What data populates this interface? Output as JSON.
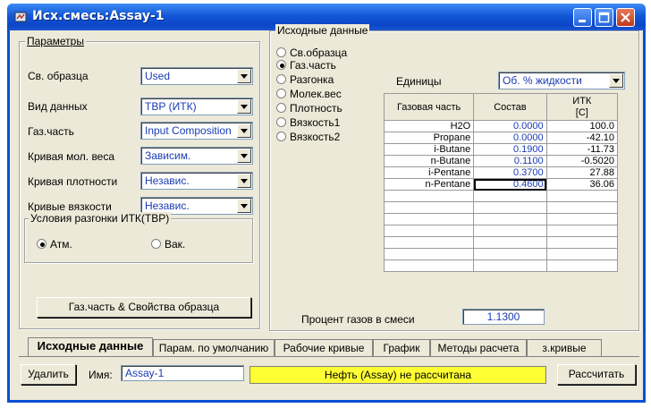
{
  "window": {
    "title": "Исх.смесь:Assay-1"
  },
  "params": {
    "group_label": "Параметры",
    "rows": [
      {
        "label": "Св. образца",
        "value": "Used"
      },
      {
        "label": "Вид данных",
        "value": "ТВР (ИТК)"
      },
      {
        "label": "Газ.часть",
        "value": "Input Composition"
      },
      {
        "label": "Кривая мол. веса",
        "value": "Зависим."
      },
      {
        "label": "Кривая плотности",
        "value": "Независ."
      },
      {
        "label": "Кривые вязкости",
        "value": "Независ."
      }
    ],
    "distill": {
      "group_label": "Условия разгонки ИТК(ТВР)",
      "options": [
        {
          "label": "Атм.",
          "selected": true
        },
        {
          "label": "Вак.",
          "selected": false
        }
      ]
    },
    "button_label": "Газ.часть & Свойства образца"
  },
  "source": {
    "group_label": "Исходные данные",
    "radios": [
      {
        "label": "Св.образца",
        "selected": false
      },
      {
        "label": "Газ.часть",
        "selected": true
      },
      {
        "label": "Разгонка",
        "selected": false
      },
      {
        "label": "Молек.вес",
        "selected": false
      },
      {
        "label": "Плотность",
        "selected": false
      },
      {
        "label": "Вязкость1",
        "selected": false
      },
      {
        "label": "Вязкость2",
        "selected": false
      }
    ],
    "units_label": "Единицы",
    "units_value": "Об. % жидкости",
    "table": {
      "headers": [
        "Газовая часть",
        "Состав",
        "ИТК",
        "[C]"
      ],
      "rows": [
        [
          "H2O",
          "0.0000",
          "100.0"
        ],
        [
          "Propane",
          "0.0000",
          "-42.10"
        ],
        [
          "i-Butane",
          "0.1900",
          "-11.73"
        ],
        [
          "n-Butane",
          "0.1100",
          "-0.5020"
        ],
        [
          "i-Pentane",
          "0.3700",
          "27.88"
        ],
        [
          "n-Pentane",
          "0.4600",
          "36.06"
        ]
      ]
    },
    "gas_percent_label": "Процент газов в смеси",
    "gas_percent_value": "1.1300"
  },
  "tabs": [
    "Исходные данные",
    "Парам. по умолчанию",
    "Рабочие кривые",
    "График",
    "Методы расчета",
    "з.кривые"
  ],
  "footer": {
    "delete_label": "Удалить",
    "name_label": "Имя:",
    "name_value": "Assay-1",
    "status": "Нефть (Assay) не рассчитана",
    "calc_label": "Рассчитать"
  },
  "colors": {
    "title_bar": "#0b46c8",
    "status_bg": "#ffff33",
    "value_text": "#1a3bb3"
  }
}
